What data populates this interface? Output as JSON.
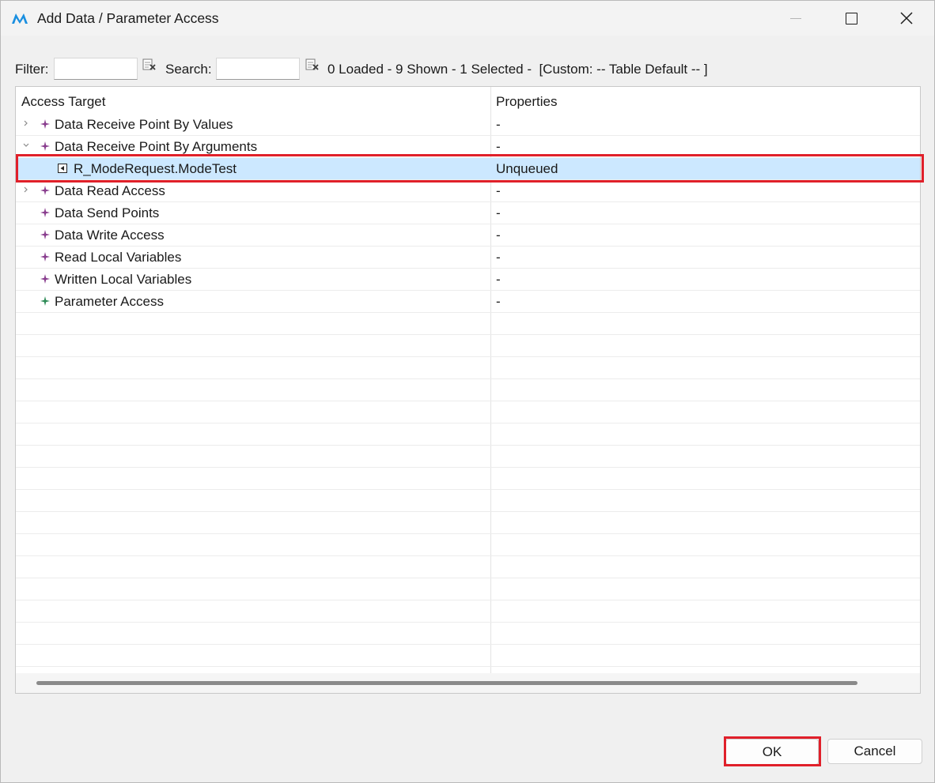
{
  "window": {
    "title": "Add Data / Parameter Access",
    "controls": {
      "minimize": "minimize-icon",
      "maximize": "maximize-icon",
      "close": "close-icon"
    }
  },
  "toolbar": {
    "filter_label": "Filter:",
    "filter_value": "",
    "search_label": "Search:",
    "search_value": "",
    "status": "0 Loaded - 9 Shown - 1 Selected -  [Custom: -- Table Default -- ]"
  },
  "table": {
    "columns": [
      "Access Target",
      "Properties"
    ],
    "rows": [
      {
        "label": "Data Receive Point By Values",
        "properties": "-",
        "expander": "collapsed",
        "icon": "purple-star-icon"
      },
      {
        "label": "Data Receive Point By Arguments",
        "properties": "-",
        "expander": "expanded",
        "icon": "purple-star-icon"
      },
      {
        "label": "R_ModeRequest.ModeTest",
        "properties": "Unqueued",
        "expander": "none",
        "icon": "port-icon",
        "selected": true
      },
      {
        "label": "Data Read Access",
        "properties": "-",
        "expander": "collapsed",
        "icon": "purple-star-icon"
      },
      {
        "label": "Data Send Points",
        "properties": "-",
        "expander": "none",
        "icon": "purple-star-icon"
      },
      {
        "label": "Data Write Access",
        "properties": "-",
        "expander": "none",
        "icon": "purple-star-icon"
      },
      {
        "label": "Read Local Variables",
        "properties": "-",
        "expander": "none",
        "icon": "purple-star-icon"
      },
      {
        "label": "Written Local Variables",
        "properties": "-",
        "expander": "none",
        "icon": "purple-star-icon"
      },
      {
        "label": "Parameter Access",
        "properties": "-",
        "expander": "none",
        "icon": "green-star-icon"
      }
    ]
  },
  "buttons": {
    "ok": "OK",
    "cancel": "Cancel"
  },
  "colors": {
    "highlight": "#e0202a",
    "selection": "#cce8ff",
    "purple_icon": "#8a3f8f",
    "green_icon": "#2e8b57",
    "brand": "#1a8fe0"
  }
}
